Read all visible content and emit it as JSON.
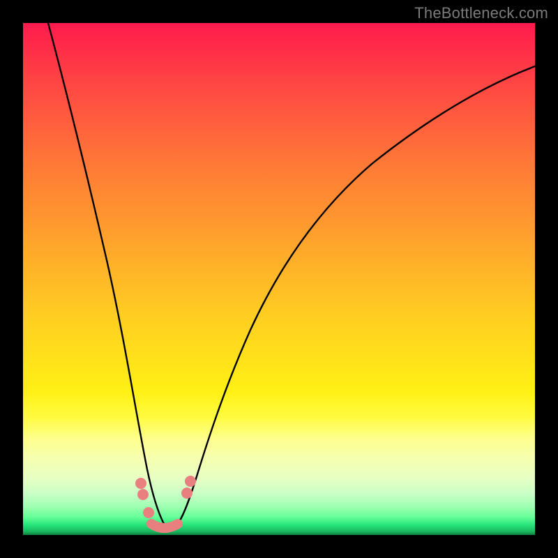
{
  "watermark": "TheBottleneck.com",
  "chart_data": {
    "type": "line",
    "title": "",
    "xlabel": "",
    "ylabel": "",
    "xlim": [
      0,
      1
    ],
    "ylim": [
      0,
      1
    ],
    "series": [
      {
        "name": "bottleneck-curve",
        "x": [
          0.05,
          0.075,
          0.1,
          0.125,
          0.15,
          0.175,
          0.2,
          0.22,
          0.24,
          0.255,
          0.265,
          0.275,
          0.285,
          0.3,
          0.32,
          0.345,
          0.37,
          0.4,
          0.44,
          0.49,
          0.55,
          0.62,
          0.7,
          0.8,
          0.9,
          1.0
        ],
        "y": [
          1.0,
          0.88,
          0.76,
          0.64,
          0.52,
          0.4,
          0.28,
          0.185,
          0.105,
          0.055,
          0.028,
          0.012,
          0.02,
          0.05,
          0.11,
          0.19,
          0.27,
          0.35,
          0.43,
          0.51,
          0.58,
          0.64,
          0.69,
          0.73,
          0.76,
          0.78
        ]
      }
    ],
    "markers": {
      "name": "highlight-dots",
      "points": [
        {
          "x": 0.228,
          "y": 0.105
        },
        {
          "x": 0.232,
          "y": 0.085
        },
        {
          "x": 0.248,
          "y": 0.04
        },
        {
          "x": 0.268,
          "y": 0.02
        },
        {
          "x": 0.29,
          "y": 0.02
        },
        {
          "x": 0.31,
          "y": 0.035
        },
        {
          "x": 0.332,
          "y": 0.1
        },
        {
          "x": 0.336,
          "y": 0.12
        }
      ]
    },
    "background_gradient": {
      "top": "#ff1a4d",
      "mid": "#ffe21a",
      "bottom": "#0f7f40"
    }
  }
}
